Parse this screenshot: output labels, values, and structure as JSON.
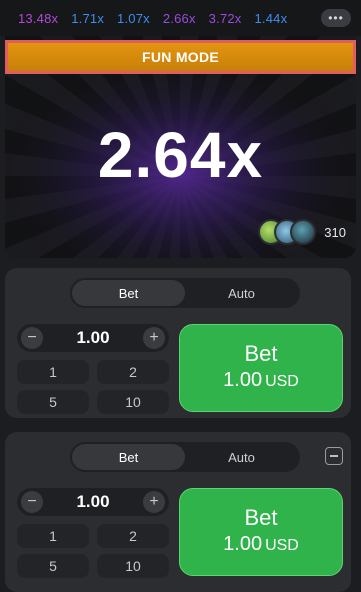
{
  "history": {
    "multipliers": [
      {
        "value": "13.48x",
        "color": "#b04bd6"
      },
      {
        "value": "1.71x",
        "color": "#3e8ef0"
      },
      {
        "value": "1.07x",
        "color": "#3e8ef0"
      },
      {
        "value": "2.66x",
        "color": "#9a4be0"
      },
      {
        "value": "3.72x",
        "color": "#9a4be0"
      },
      {
        "value": "1.44x",
        "color": "#3e8ef0"
      }
    ],
    "more_icon": "more-dots-icon"
  },
  "banner": {
    "label": "FUN MODE",
    "color": "#e3950f"
  },
  "game": {
    "multiplier": "2.64x",
    "player_count": "310"
  },
  "panels": [
    {
      "tabs": [
        "Bet",
        "Auto"
      ],
      "amount": "1.00",
      "quick": [
        "1",
        "2",
        "5",
        "10"
      ],
      "bet_label": "Bet",
      "bet_value": "1.00",
      "currency": "USD",
      "button_color": "#2fb34a"
    },
    {
      "tabs": [
        "Bet",
        "Auto"
      ],
      "amount": "1.00",
      "quick": [
        "1",
        "2",
        "5",
        "10"
      ],
      "bet_label": "Bet",
      "bet_value": "1.00",
      "currency": "USD",
      "button_color": "#2fb34a"
    }
  ]
}
